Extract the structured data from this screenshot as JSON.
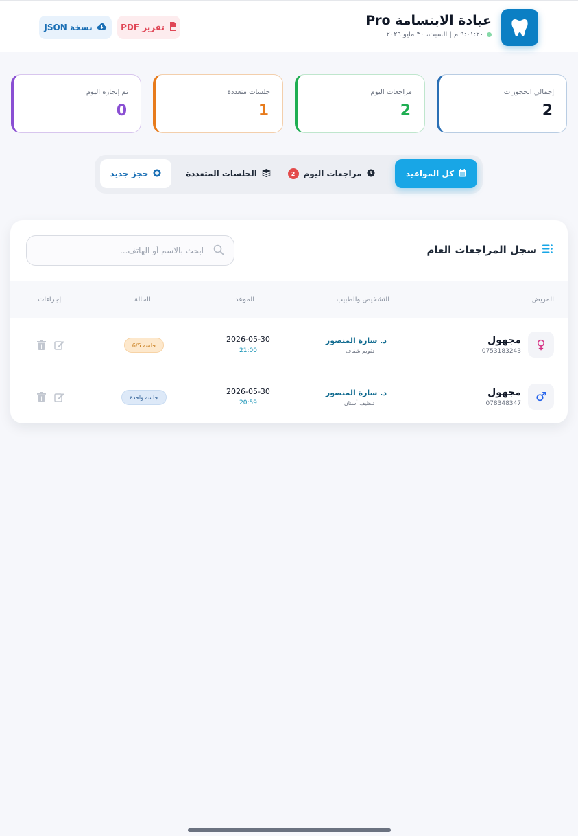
{
  "header": {
    "title": "عيادة الابتسامة Pro",
    "subtitle": "٩:٠١:٢٠ م | السبت، ٣٠ مايو ٢٠٢٦",
    "pdf_button": "تقرير PDF",
    "json_button": "نسخة JSON"
  },
  "stats": [
    {
      "label": "إجمالي الحجوزات",
      "value": "2"
    },
    {
      "label": "مراجعات اليوم",
      "value": "2"
    },
    {
      "label": "جلسات متعددة",
      "value": "1"
    },
    {
      "label": "تم إنجازه اليوم",
      "value": "0"
    }
  ],
  "tabs": {
    "all": "كل المواعيد",
    "today": "مراجعات اليوم",
    "today_count": "2",
    "multi": "الجلسات المتعددة",
    "new_booking": "حجز جديد"
  },
  "panel": {
    "title": "سجل المراجعات العام",
    "search_placeholder": "ابحث بالاسم أو الهاتف..."
  },
  "table": {
    "headers": {
      "patient": "المريض",
      "diagnosis_doctor": "التشخيص والطبيب",
      "appointment": "الموعد",
      "status": "الحالة",
      "actions": "إجراءات"
    },
    "rows": [
      {
        "gender": "female",
        "gender_symbol": "♀",
        "name": "مجهول",
        "phone": "0753183243",
        "doctor": "د. سارة المنصور",
        "diagnosis": "تقويم شفاف",
        "date": "2026-05-30",
        "time": "21:00",
        "status": "جلسة 6/5",
        "status_color": "#c57816"
      },
      {
        "gender": "male",
        "gender_symbol": "♂",
        "name": "مجهول",
        "phone": "078348347",
        "doctor": "د. سارة المنصور",
        "diagnosis": "تنظيف أسنان",
        "date": "2026-05-30",
        "time": "20:59",
        "status": "جلسة واحدة",
        "status_color": "#2f5f96"
      }
    ]
  },
  "colors": {
    "accent": "#18a6e6",
    "brand": "#0b7fc4",
    "danger": "#e04656",
    "success": "#1fae52",
    "warning": "#e77b1c",
    "purple": "#8a4fd3"
  }
}
